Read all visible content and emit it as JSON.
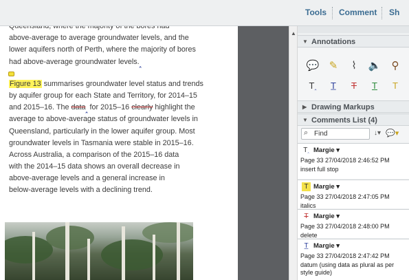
{
  "toolbar": {
    "tools_label": "Tools",
    "comment_label": "Comment",
    "share_label": "Sh"
  },
  "document": {
    "lines": [
      "Queensland, where the majority of the bores had",
      "above-average to average groundwater levels, and the",
      "lower aquifers north of Perth, where the majority of bores",
      "had above-average groundwater levels."
    ],
    "para2": {
      "l1_highlight": "Figure 13",
      "l1_rest": " summarises groundwater level status and trends",
      "l2": "by aquifer group for each State and Territory, for 2014–15",
      "l3_a": "and 2015–16. The ",
      "l3_strike1": "data",
      "l3_b": " for 2015–16 ",
      "l3_strike2": "clearly",
      "l3_c": " highlight the",
      "l4": "average to above-average status of groundwater levels in",
      "l5": "Queensland, particularly in the lower aquifer group. Most",
      "l6": "groundwater levels in Tasmania were stable in 2015–16.",
      "l7": "Across Australia, a comparison of the 2015–16 data",
      "l8": "with the 2014–15 data shows an overall decrease in",
      "l9": "above-average levels and a general increase in",
      "l10": "below-average levels with a declining trend."
    }
  },
  "pane": {
    "annotations_label": "Annotations",
    "drawing_markups_label": "Drawing Markups",
    "comments_list_label": "Comments List (4)",
    "search_placeholder": "Find",
    "annotation_tools": [
      {
        "icon": "sticky-note-icon",
        "glyph": "💬"
      },
      {
        "icon": "highlight-text-icon",
        "glyph": "🖍"
      },
      {
        "icon": "attach-file-icon",
        "glyph": "📎"
      },
      {
        "icon": "record-audio-icon",
        "glyph": "🔊"
      },
      {
        "icon": "stamp-icon",
        "glyph": "👤"
      },
      {
        "icon": "insert-text-icon",
        "glyph": "Tₐ"
      },
      {
        "icon": "replace-text-icon",
        "glyph": "T̲"
      },
      {
        "icon": "strikethrough-icon",
        "glyph": "T̶"
      },
      {
        "icon": "underline-icon",
        "glyph": "T̲"
      },
      {
        "icon": "add-note-to-text-icon",
        "glyph": "T"
      }
    ],
    "comments": [
      {
        "icon": "insert-text-icon",
        "author": "Margie",
        "meta": "Page 33  27/04/2018 2:46:52 PM",
        "body": "insert full stop"
      },
      {
        "icon": "highlight-icon",
        "author": "Margie",
        "meta": "Page 33  27/04/2018 2:47:05 PM",
        "body": "italics"
      },
      {
        "icon": "strikethrough-icon",
        "author": "Margie",
        "meta": "Page 33  27/04/2018 2:48:00 PM",
        "body": "delete"
      },
      {
        "icon": "replace-text-icon",
        "author": "Margie",
        "meta": "Page 33  27/04/2018 2:47:42 PM",
        "body": "datum (using data as plural as per style guide)"
      }
    ]
  },
  "colors": {
    "accent": "#3b6c92",
    "highlight": "#fff35a",
    "gutter": "#5d5f62"
  }
}
